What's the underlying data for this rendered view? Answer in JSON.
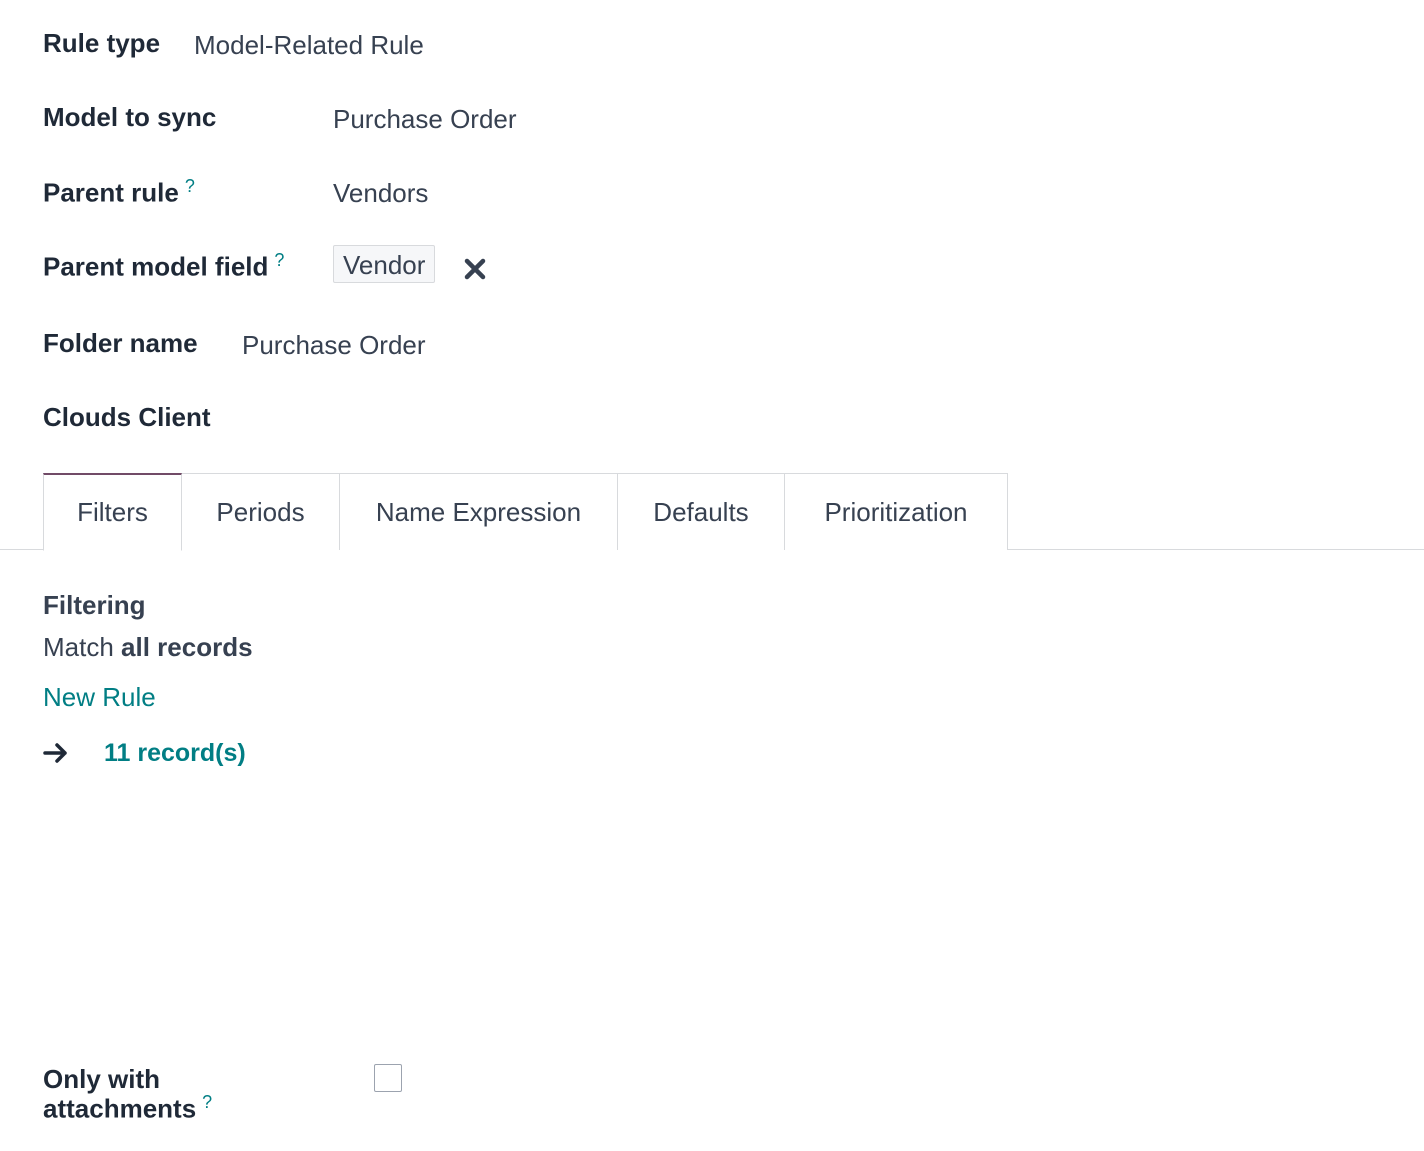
{
  "form": {
    "rule_type_label": "Rule type",
    "rule_type_value": "Model-Related Rule",
    "model_to_sync_label": "Model to sync",
    "model_to_sync_value": "Purchase Order",
    "parent_rule_label": "Parent rule",
    "parent_rule_value": "Vendors",
    "parent_model_field_label": "Parent model field",
    "parent_model_field_tag": "Vendor",
    "folder_name_label": "Folder name",
    "folder_name_value": "Purchase Order",
    "clouds_client_label": "Clouds Client",
    "help_marker": "?",
    "only_with_attachments_label_line1": "Only with",
    "only_with_attachments_label_line2": "attachments",
    "only_with_attachments_checked": false
  },
  "tabs": [
    {
      "label": "Filters",
      "active": true
    },
    {
      "label": "Periods",
      "active": false
    },
    {
      "label": "Name Expression",
      "active": false
    },
    {
      "label": "Defaults",
      "active": false
    },
    {
      "label": "Prioritization",
      "active": false
    }
  ],
  "filters": {
    "heading": "Filtering",
    "match_prefix": "Match",
    "match_value": "all records",
    "new_rule_link": "New Rule",
    "records_link": "11 record(s)",
    "arrow_icon": "arrow-right-icon"
  },
  "colors": {
    "accent": "#017e84",
    "tab_active_border": "#714b67",
    "text": "#374151",
    "label": "#1f2937"
  }
}
